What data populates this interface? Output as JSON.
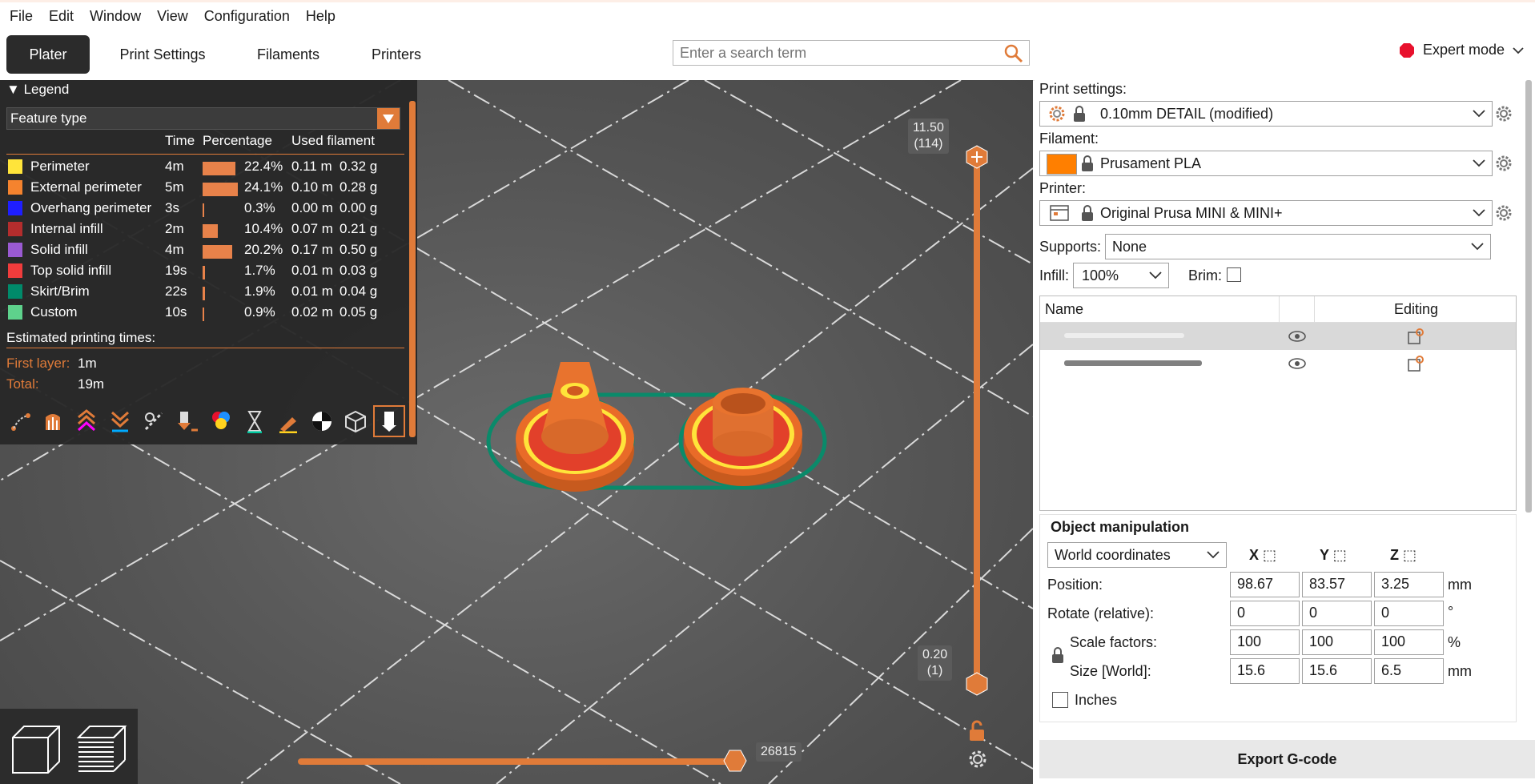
{
  "menu": [
    "File",
    "Edit",
    "Window",
    "View",
    "Configuration",
    "Help"
  ],
  "tabs": [
    "Plater",
    "Print Settings",
    "Filaments",
    "Printers"
  ],
  "search": {
    "placeholder": "Enter a search term"
  },
  "mode": {
    "label": "Expert mode",
    "color": "#e8112d"
  },
  "legend": {
    "title": "Legend",
    "view_type": "Feature type",
    "columns": {
      "time": "Time",
      "percentage": "Percentage",
      "used": "Used filament"
    },
    "features": [
      {
        "name": "Perimeter",
        "color": "#ffe43a",
        "time": "4m",
        "pct": "22.4%",
        "pct_value": 22.4,
        "m": "0.11 m",
        "g": "0.32 g"
      },
      {
        "name": "External perimeter",
        "color": "#f5832e",
        "time": "5m",
        "pct": "24.1%",
        "pct_value": 24.1,
        "m": "0.10 m",
        "g": "0.28 g"
      },
      {
        "name": "Overhang perimeter",
        "color": "#1e1eff",
        "time": "3s",
        "pct": "0.3%",
        "pct_value": 0.3,
        "m": "0.00 m",
        "g": "0.00 g"
      },
      {
        "name": "Internal infill",
        "color": "#b42d2d",
        "time": "2m",
        "pct": "10.4%",
        "pct_value": 10.4,
        "m": "0.07 m",
        "g": "0.21 g"
      },
      {
        "name": "Solid infill",
        "color": "#9a5ad2",
        "time": "4m",
        "pct": "20.2%",
        "pct_value": 20.2,
        "m": "0.17 m",
        "g": "0.50 g"
      },
      {
        "name": "Top solid infill",
        "color": "#f03c3c",
        "time": "19s",
        "pct": "1.7%",
        "pct_value": 1.7,
        "m": "0.01 m",
        "g": "0.03 g"
      },
      {
        "name": "Skirt/Brim",
        "color": "#008a6a",
        "time": "22s",
        "pct": "1.9%",
        "pct_value": 1.9,
        "m": "0.01 m",
        "g": "0.04 g"
      },
      {
        "name": "Custom",
        "color": "#5ed28c",
        "time": "10s",
        "pct": "0.9%",
        "pct_value": 0.9,
        "m": "0.02 m",
        "g": "0.05 g"
      }
    ],
    "estimated_label": "Estimated printing times:",
    "first_layer_label": "First layer:",
    "first_layer_value": "1m",
    "total_label": "Total:",
    "total_value": "19m"
  },
  "slider": {
    "top_height": "11.50",
    "top_layer": "(114)",
    "bottom_height": "0.20",
    "bottom_layer": "(1)",
    "move_value": "26815"
  },
  "sidebar": {
    "print_settings_label": "Print settings:",
    "print_settings_value": "0.10mm DETAIL (modified)",
    "filament_label": "Filament:",
    "filament_value": "Prusament PLA",
    "filament_color": "#ff7f00",
    "printer_label": "Printer:",
    "printer_value": "Original Prusa MINI & MINI+",
    "supports_label": "Supports:",
    "supports_value": "None",
    "infill_label": "Infill:",
    "infill_value": "100%",
    "brim_label": "Brim:",
    "list_name_header": "Name",
    "list_editing_header": "Editing",
    "om_title": "Object manipulation",
    "coords_value": "World coordinates",
    "axes": [
      "X",
      "Y",
      "Z"
    ],
    "rows": [
      {
        "label": "Position:",
        "x": "98.67",
        "y": "83.57",
        "z": "3.25",
        "unit": "mm"
      },
      {
        "label": "Rotate (relative):",
        "x": "0",
        "y": "0",
        "z": "0",
        "unit": "°"
      },
      {
        "label": "Scale factors:",
        "x": "100",
        "y": "100",
        "z": "100",
        "unit": "%"
      },
      {
        "label": "Size [World]:",
        "x": "15.6",
        "y": "15.6",
        "z": "6.5",
        "unit": "mm"
      }
    ],
    "inches_label": "Inches",
    "export_label": "Export G-code"
  }
}
